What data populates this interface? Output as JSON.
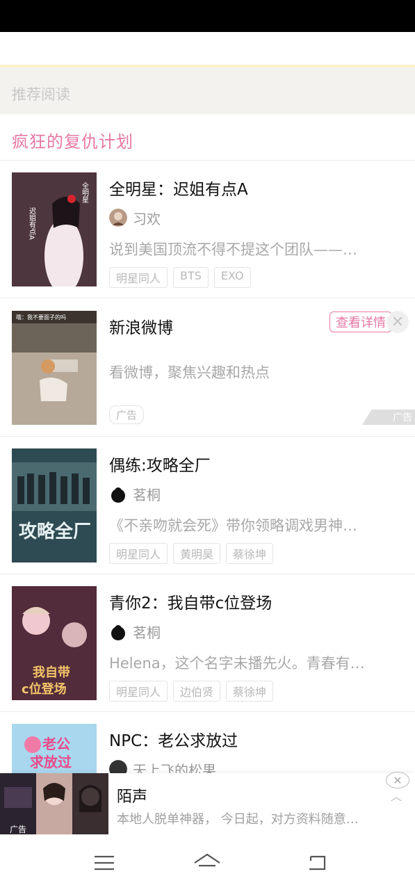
{
  "section": {
    "header": "推荐阅读",
    "list_title": "疯狂的复仇计划"
  },
  "items": [
    {
      "title": "全明星：迟姐有点A",
      "author": "习欢",
      "desc": "说到美国顶流不得不提这个团队——…",
      "tags": [
        "明星同人",
        "BTS",
        "EXO"
      ],
      "cover_text": "迟姐有点A"
    },
    {
      "title": "新浪微博",
      "desc": "看微博，聚焦兴趣和热点",
      "detail_button": "查看详情",
      "ad_tag": "广告",
      "ad_corner": "广告",
      "cover_caption": "哦：我不要面子的吗"
    },
    {
      "title": "偶练:攻略全厂",
      "author": "茗桐",
      "desc": "《不亲吻就会死》带你领略调戏男神…",
      "tags": [
        "明星同人",
        "黄明昊",
        "蔡徐坤"
      ],
      "cover_text": "攻略全厂"
    },
    {
      "title": "青你2：我自带c位登场",
      "author": "茗桐",
      "desc": "Helena，这个名字未播先火。青春有…",
      "tags": [
        "明星同人",
        "边伯贤",
        "蔡徐坤"
      ],
      "cover_text": "我自带c位登场"
    },
    {
      "title": "NPC：老公求放过",
      "author": "天上飞的松果",
      "cover_text": "老公求放过"
    }
  ],
  "bottom_ad": {
    "title": "陌声",
    "desc": "本地人脱单神器， 今日起，对方资料随意…",
    "label": "广告"
  },
  "colors": {
    "accent": "#e678a4",
    "header_bg": "#f3f2ee"
  }
}
